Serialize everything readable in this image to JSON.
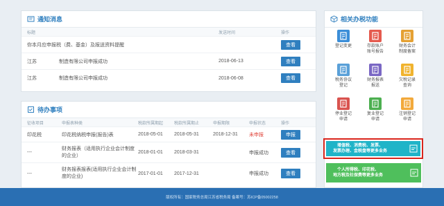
{
  "notice": {
    "title": "通知消息",
    "cols": [
      "标题",
      "发送时间",
      "操作"
    ],
    "rows": [
      {
        "title": "你本月应申报税（费、基金）及报送资料提醒",
        "date": "",
        "action": "查看"
      },
      {
        "title": "江苏",
        "subtitle": "制造有限公司申报成功",
        "date": "2018-06-13",
        "action": "查看"
      },
      {
        "title": "江苏",
        "subtitle": "制造有限公司申报成功",
        "date": "2018-06-08",
        "action": "查看"
      }
    ]
  },
  "todo": {
    "title": "待办事项",
    "cols": [
      "征收项目",
      "申报表种类",
      "税款所属期起",
      "税款所属期止",
      "申报期限",
      "申报状态",
      "操作"
    ],
    "rows": [
      {
        "item": "印花税",
        "form": "印花税纳税申报(报告)表",
        "start": "2018-05-01",
        "end": "2018-05-31",
        "deadline": "2018-12-31",
        "status": "未申报",
        "action": "申报"
      },
      {
        "item": "---",
        "form": "财务报表（适用执行企业会计制度的企业）",
        "start": "2018-01-01",
        "end": "2018-03-31",
        "deadline": "",
        "status": "申报成功",
        "action": "查看"
      },
      {
        "item": "---",
        "form": "财务报表报表(适用执行企业会计制度的企业)",
        "start": "2017-01-01",
        "end": "2017-12-31",
        "deadline": "",
        "status": "申报成功",
        "action": "查看"
      }
    ]
  },
  "related": {
    "title": "相关办税功能",
    "items": [
      {
        "label": "登记变更",
        "icon": "register-change-icon",
        "color": "#3b8ed8"
      },
      {
        "label": "存款账户\n账号报告",
        "icon": "bank-account-icon",
        "color": "#e55a4e"
      },
      {
        "label": "财务会计\n制度备案",
        "icon": "accounting-icon",
        "color": "#e5a133"
      },
      {
        "label": "税务协议\n登记",
        "icon": "agreement-icon",
        "color": "#5aa0d8"
      },
      {
        "label": "财务报表\n报送",
        "icon": "report-icon",
        "color": "#7a67c4"
      },
      {
        "label": "欠税记录\n查询",
        "icon": "debt-icon",
        "color": "#f0b32e"
      },
      {
        "label": "停业登记\n申请",
        "icon": "suspend-icon",
        "color": "#d9534f"
      },
      {
        "label": "复业登记\n申请",
        "icon": "resume-icon",
        "color": "#4caf50"
      },
      {
        "label": "注销登记\n申请",
        "icon": "cancel-icon",
        "color": "#f2a93b"
      }
    ],
    "banner1": "增值税、消费税、发票、\n发票办理、金税盘等更多业务",
    "banner2": "个人所得税、印花税、\n地方税及社保费等更多业务"
  },
  "footer": {
    "text": "版权所有：国家税务总局江苏省税务局    备案号：苏ICP备05002258"
  }
}
